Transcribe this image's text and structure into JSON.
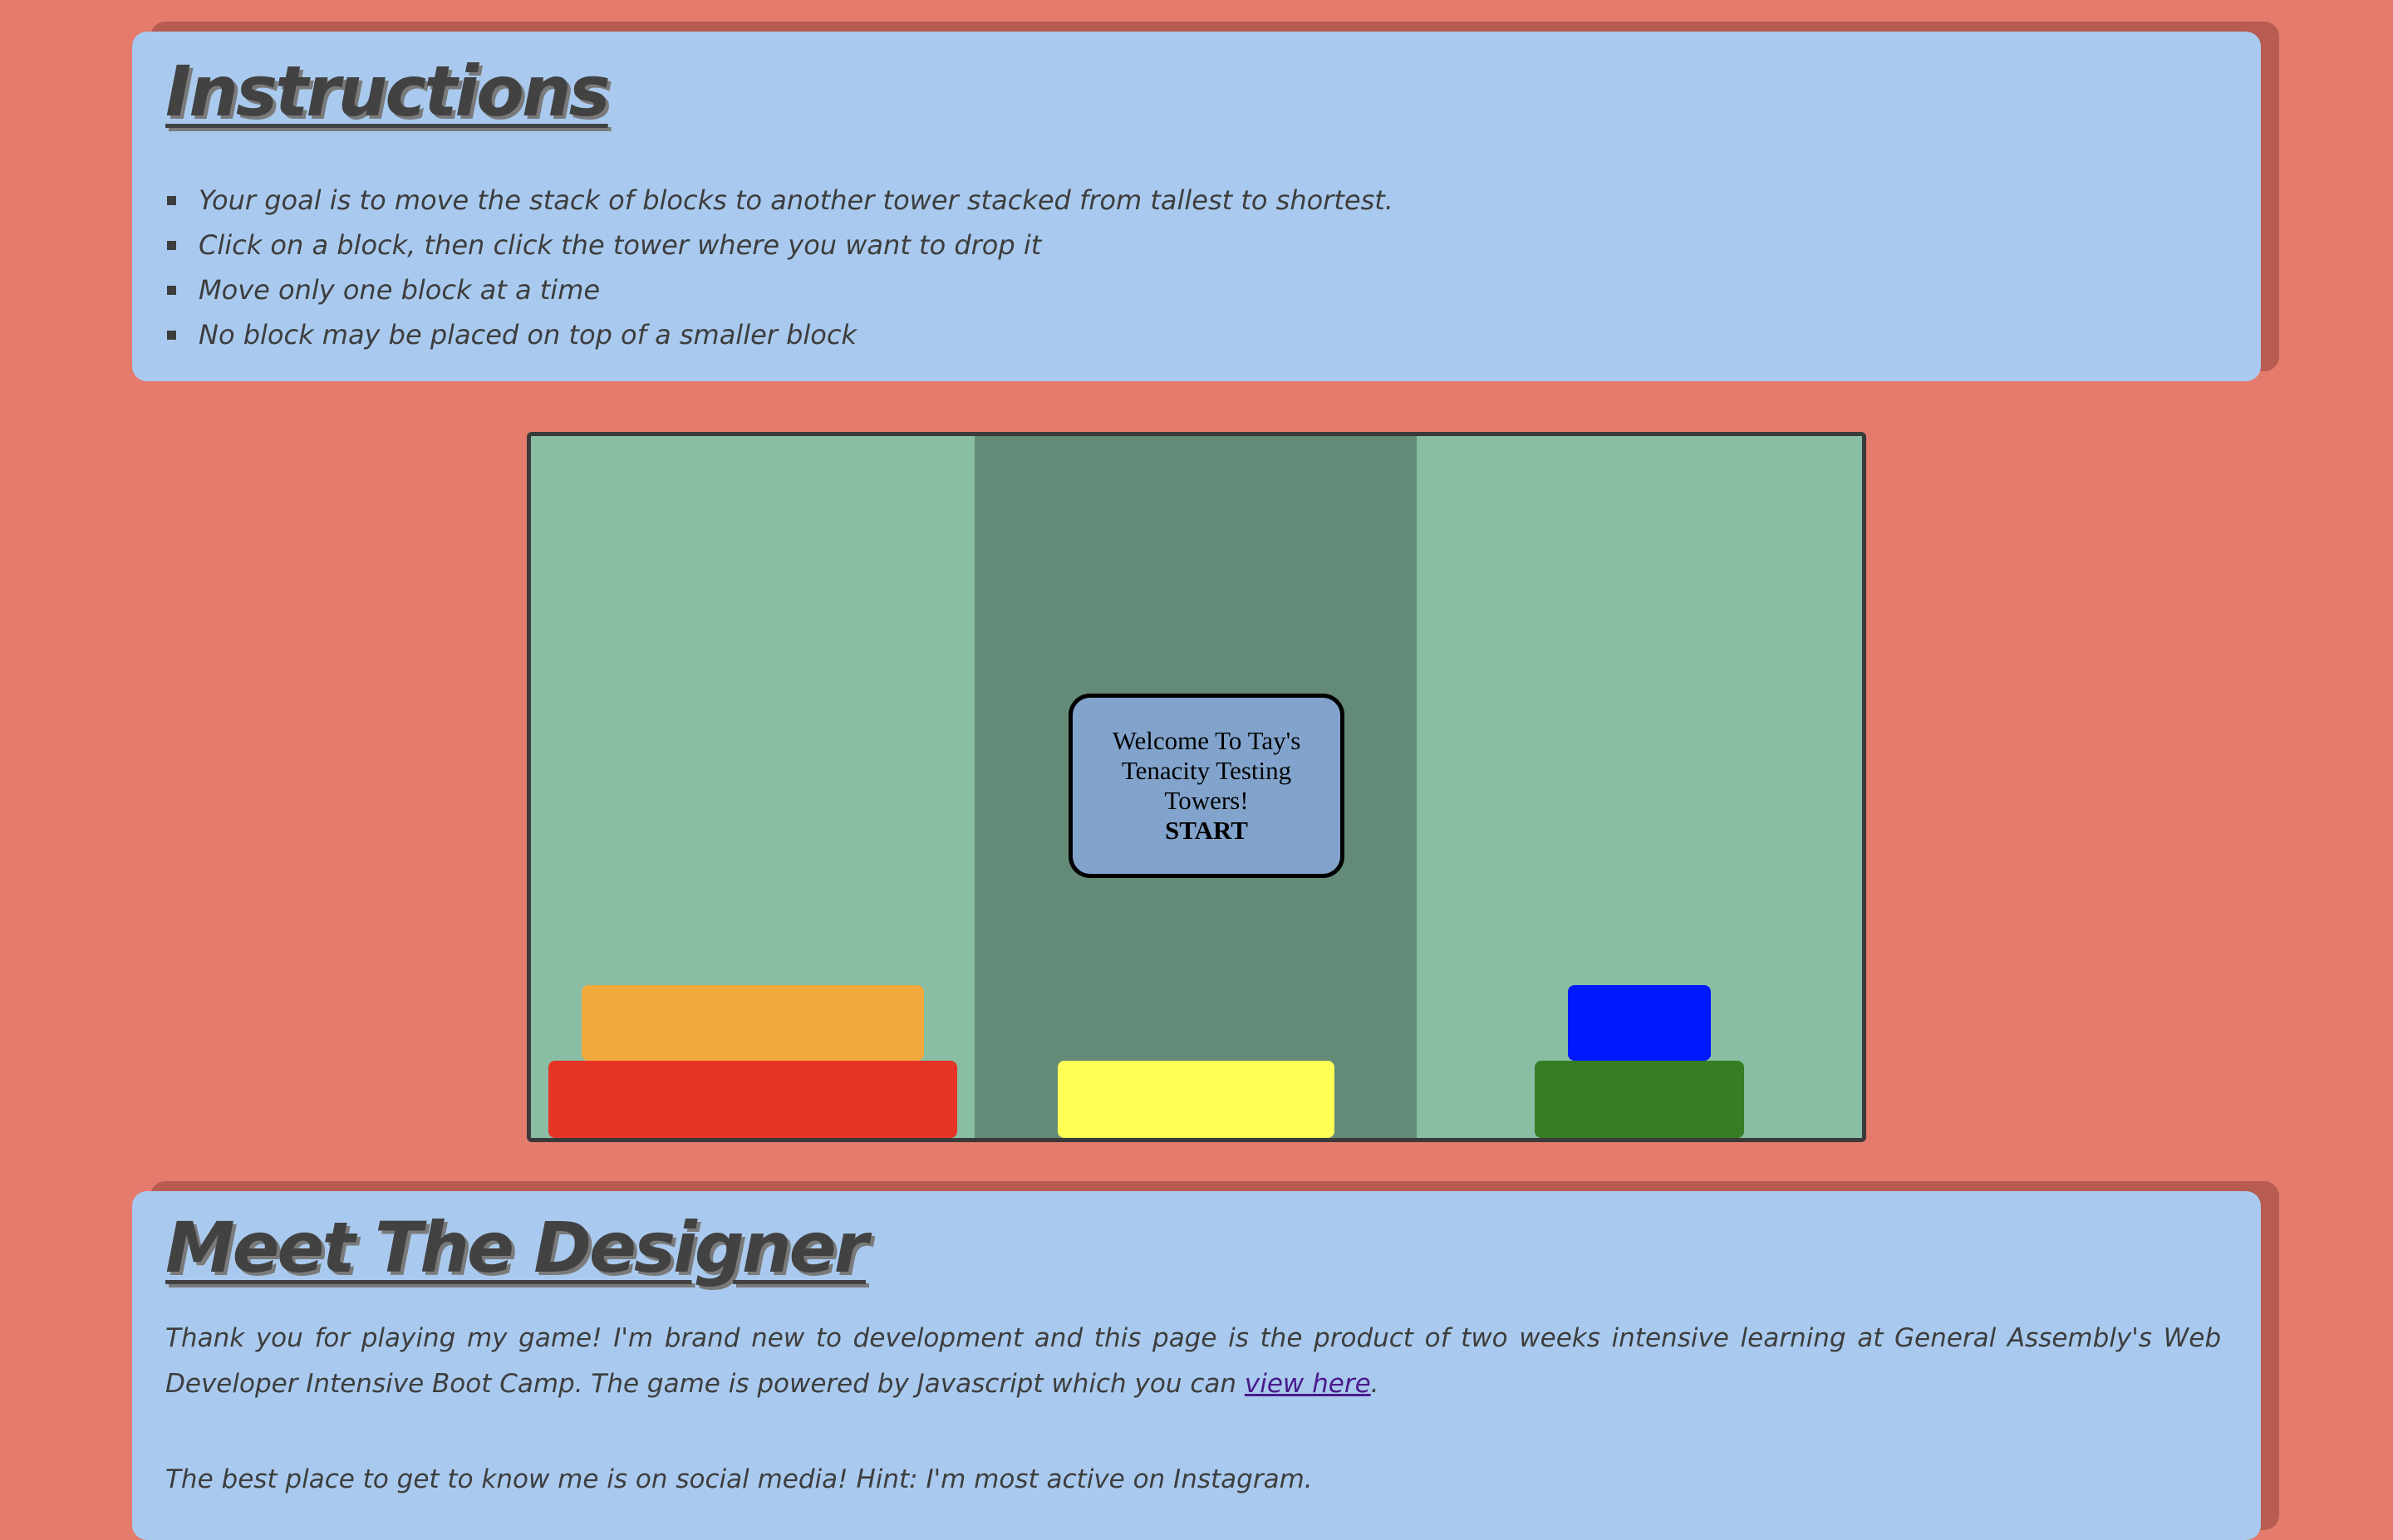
{
  "instructions": {
    "title": "Instructions",
    "items": [
      "Your goal is to move the stack of blocks to another tower stacked from tallest to shortest.",
      "Click on a block, then click the tower where you want to drop it",
      "Move only one block at a time",
      "No block may be placed on top of a smaller block"
    ]
  },
  "game": {
    "welcome_text": "Welcome To Tay's Tenacity Testing Towers!",
    "start_label": "START",
    "towers": [
      {
        "name": "left",
        "blocks": [
          "orange",
          "red"
        ]
      },
      {
        "name": "middle",
        "blocks": [
          "yellow"
        ]
      },
      {
        "name": "right",
        "blocks": [
          "blue",
          "green"
        ]
      }
    ],
    "colors": {
      "orange": "#f2a93c",
      "red": "#e83327",
      "yellow": "#ffff55",
      "blue": "#0018fc",
      "green": "#367d24"
    }
  },
  "designer": {
    "title": "Meet The Designer",
    "para1_text": "Thank you for playing my game! I'm brand new to development and this page is the product of two weeks intensive learning at General Assembly's Web Developer Intensive Boot Camp. The game is powered by Javascript which you can ",
    "para1_link": "view here",
    "para1_end": ".",
    "para2_text": "The best place to get to know me is on social media! Hint: I'm most active on Instagram."
  }
}
